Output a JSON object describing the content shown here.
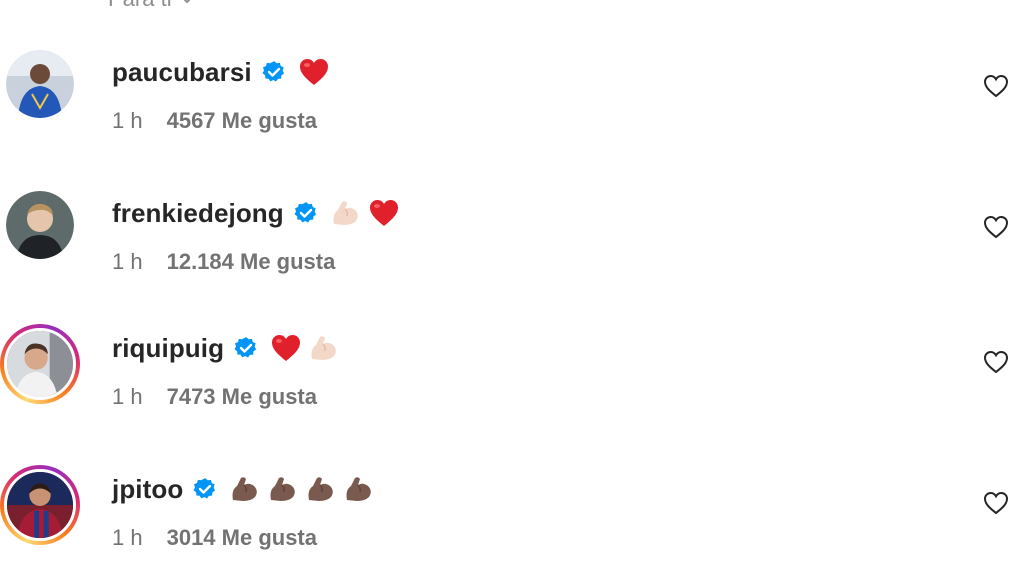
{
  "sort": {
    "label": "Para ti",
    "icon": "chevron-down-icon"
  },
  "comments": [
    {
      "username": "paucubarsi",
      "verified": true,
      "emojis": [
        "red-heart-emoji"
      ],
      "time": "1 h",
      "likes": "4567 Me gusta",
      "story_ring": false,
      "like_icon": "heart-outline-icon"
    },
    {
      "username": "frenkiedejong",
      "verified": true,
      "emojis": [
        "flexed-biceps-light-emoji",
        "red-heart-emoji"
      ],
      "time": "1 h",
      "likes": "12.184 Me gusta",
      "story_ring": false,
      "like_icon": "heart-outline-icon"
    },
    {
      "username": "riquipuig",
      "verified": true,
      "emojis": [
        "red-heart-emoji",
        "flexed-biceps-light-emoji"
      ],
      "time": "1 h",
      "likes": "7473 Me gusta",
      "story_ring": true,
      "like_icon": "heart-outline-icon"
    },
    {
      "username": "jpitoo",
      "verified": true,
      "emojis": [
        "flexed-biceps-dark-emoji",
        "flexed-biceps-dark-emoji",
        "flexed-biceps-dark-emoji",
        "flexed-biceps-dark-emoji"
      ],
      "time": "1 h",
      "likes": "3014 Me gusta",
      "story_ring": true,
      "like_icon": "heart-outline-icon"
    }
  ],
  "colors": {
    "verified_blue": "#0095f6",
    "heart_red": "#e0202a",
    "meta_gray": "#737373",
    "text_dark": "#262626"
  }
}
